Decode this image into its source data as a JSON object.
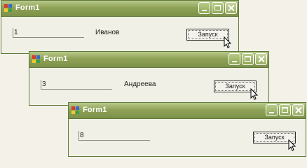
{
  "windows": [
    {
      "title": "Form1",
      "textbox_value": "1",
      "label": "Иванов",
      "button_label": "Запуск"
    },
    {
      "title": "Form1",
      "textbox_value": "3",
      "label": "Андреева",
      "button_label": "Запуск"
    },
    {
      "title": "Form1",
      "textbox_value": "8",
      "label": "",
      "button_label": "Запуск"
    }
  ],
  "icons": [
    "app-icon",
    "minimize-icon",
    "maximize-icon",
    "close-icon",
    "mouse-cursor-icon"
  ],
  "colors": {
    "titlebar": "#8fa257",
    "border": "#5f7a3a",
    "client": "#f1f0e6"
  }
}
